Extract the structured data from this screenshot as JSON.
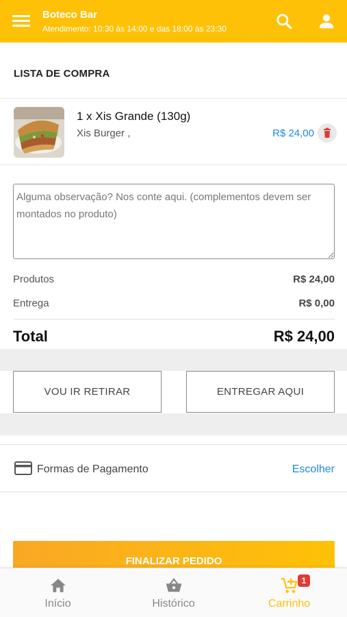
{
  "header": {
    "title": "Boteco Bar",
    "subtitle": "Atendimento: 10:30 às 14:00 e das 18:00 às 23:30",
    "background_color": "#FFC107",
    "menu_icon": "menu-icon",
    "search_icon": "search-icon",
    "user_icon": "user-icon"
  },
  "cart": {
    "section_title": "LISTA DE COMPRA",
    "items": [
      {
        "name": "1 x Xis Grande (130g)",
        "description": "Xis Burger ,",
        "price": "R$ 24,00",
        "delete_icon": "trash-icon"
      }
    ]
  },
  "observation": {
    "placeholder": "Alguma observação? Nos conte aqui. (complementos devem ser montados no produto)",
    "value": ""
  },
  "summary": {
    "products_label": "Produtos",
    "products_value": "R$ 24,00",
    "delivery_label": "Entrega",
    "delivery_value": "R$ 0,00",
    "total_label": "Total",
    "total_value": "R$ 24,00"
  },
  "delivery_options": {
    "pickup_label": "VOU IR RETIRAR",
    "deliver_label": "ENTREGAR AQUI"
  },
  "payment": {
    "label": "Formas de Pagamento",
    "action": "Escolher",
    "icon": "credit-card-icon"
  },
  "finalize_button": "FINALIZAR PEDIDO",
  "bottom_nav": {
    "items": [
      {
        "label": "Início",
        "icon": "home-icon",
        "active": false
      },
      {
        "label": "Histórico",
        "icon": "basket-icon",
        "active": false
      },
      {
        "label": "Carrinho",
        "icon": "cart-icon",
        "active": true
      }
    ],
    "cart_badge": "1"
  },
  "colors": {
    "accent": "#FFC107",
    "link": "#1e88e5",
    "badge": "#e53935"
  }
}
